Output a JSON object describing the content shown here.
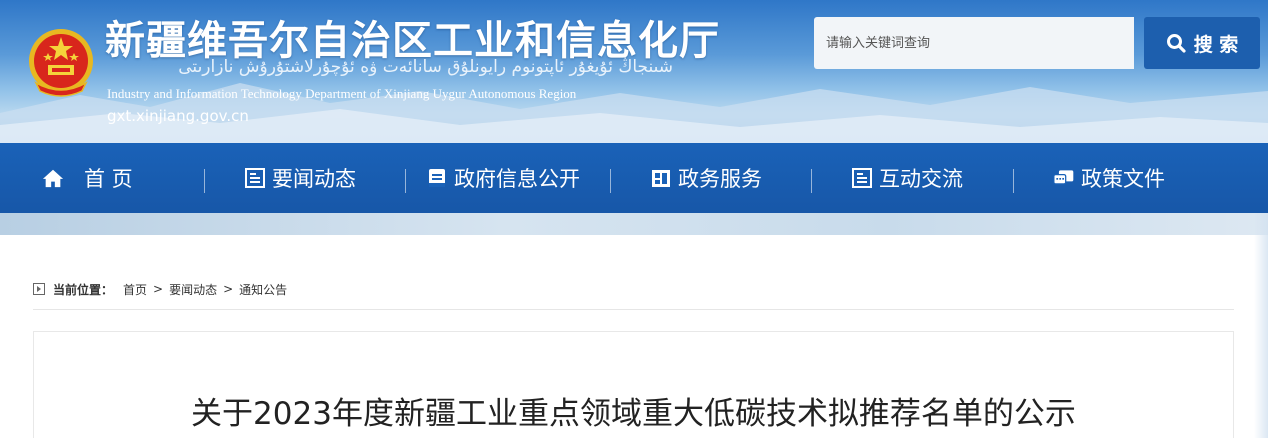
{
  "header": {
    "title": "新疆维吾尔自治区工业和信息化厅",
    "uyghur": "شىنجاڭ ئۇيغۇر ئاپتونوم رايونلۇق سانائەت ۋە ئۇچۇرلاشتۇرۇش نازارىتى",
    "english": "Industry and Information Technology Department of Xinjiang Uygur Autonomous Region",
    "domain": "gxt.xinjiang.gov.cn",
    "emblem_icon": "national-emblem-icon"
  },
  "search": {
    "placeholder": "请输入关键词查询",
    "button_label": "搜 索",
    "icon": "search-icon"
  },
  "nav": {
    "items": [
      {
        "label": "首 页",
        "icon": "home-icon"
      },
      {
        "label": "要闻动态",
        "icon": "news-icon"
      },
      {
        "label": "政府信息公开",
        "icon": "info-icon"
      },
      {
        "label": "政务服务",
        "icon": "service-icon"
      },
      {
        "label": "互动交流",
        "icon": "interaction-icon"
      },
      {
        "label": "政策文件",
        "icon": "policy-icon"
      }
    ]
  },
  "breadcrumb": {
    "label": "当前位置：",
    "items": [
      "首页",
      "要闻动态",
      "通知公告"
    ],
    "separator": ">"
  },
  "article": {
    "title": "关于2023年度新疆工业重点领域重大低碳技术拟推荐名单的公示"
  },
  "colors": {
    "nav_bg": "#1a62b8",
    "search_button": "#1d5fae"
  }
}
